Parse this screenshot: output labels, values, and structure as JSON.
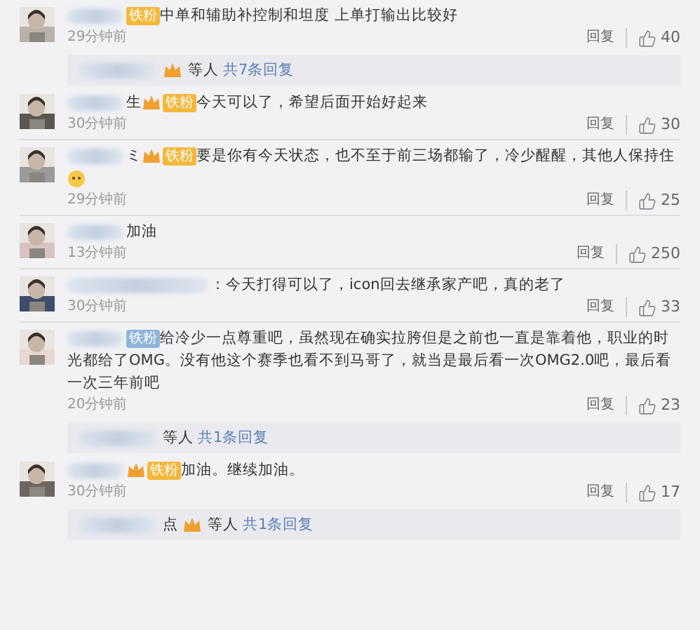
{
  "comments": [
    {
      "badge": {
        "kind": "fan",
        "crown": false,
        "text": "铁粉"
      },
      "text": "中单和辅助补控制和坦度 上单打输出比较好",
      "time": "29分钟前",
      "reply": "回复",
      "likes": "40",
      "thread": {
        "crown": true,
        "who": "等人",
        "link": "共7条回复"
      }
    },
    {
      "name_fragment": "生",
      "badge": {
        "kind": "fan",
        "crown": true,
        "text": "铁粉"
      },
      "text": "今天可以了，希望后面开始好起来",
      "time": "30分钟前",
      "reply": "回复",
      "likes": "30"
    },
    {
      "name_fragment": "ミ",
      "badge": {
        "kind": "fan",
        "crown": true,
        "text": "铁粉"
      },
      "text": "要是你有今天状态，也不至于前三场都输了，冷少醒醒，其他人保持住",
      "emoji": true,
      "time": "29分钟前",
      "reply": "回复",
      "likes": "25"
    },
    {
      "text": "加油",
      "time": "13分钟前",
      "reply": "回复",
      "likes": "250"
    },
    {
      "text": "：今天打得可以了，icon回去继承家产吧，真的老了",
      "time": "30分钟前",
      "reply": "回复",
      "likes": "33"
    },
    {
      "badge": {
        "kind": "plain",
        "crown": false,
        "text": "铁粉"
      },
      "text": "给冷少一点尊重吧，虽然现在确实拉胯但是之前也一直是靠着他，职业的时光都给了OMG。没有他这个赛季也看不到马哥了，就当是最后看一次OMG2.0吧，最后看一次三年前吧",
      "time": "20分钟前",
      "reply": "回复",
      "likes": "23",
      "thread": {
        "crown": false,
        "who": "等人",
        "link": "共1条回复"
      }
    },
    {
      "badge": {
        "kind": "fan",
        "crown": true,
        "text": "铁粉"
      },
      "text": "加油。继续加油。",
      "time": "30分钟前",
      "reply": "回复",
      "likes": "17",
      "thread": {
        "crown": true,
        "fragment": "点",
        "who": "等人",
        "link": "共1条回复"
      }
    }
  ]
}
